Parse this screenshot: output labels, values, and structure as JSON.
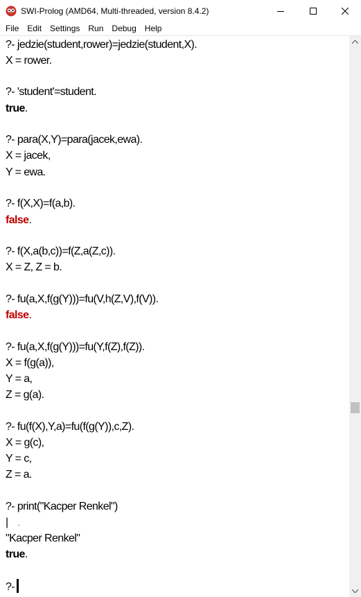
{
  "window": {
    "title": "SWI-Prolog (AMD64, Multi-threaded, version 8.4.2)"
  },
  "menu": {
    "file": "File",
    "edit": "Edit",
    "settings": "Settings",
    "run": "Run",
    "debug": "Debug",
    "help": "Help"
  },
  "console": {
    "q1": "?- jedzie(student,rower)=jedzie(student,X).",
    "a1": "X = rower.",
    "q2": "?- 'student'=student.",
    "a2": "true",
    "a2_dot": ".",
    "q3": "?- para(X,Y)=para(jacek,ewa).",
    "a3_1": "X = jacek,",
    "a3_2": "Y = ewa.",
    "q4": "?- f(X,X)=f(a,b).",
    "a4": "false",
    "a4_dot": ".",
    "q5": "?- f(X,a(b,c))=f(Z,a(Z,c)).",
    "a5": "X = Z, Z = b.",
    "q6": "?- fu(a,X,f(g(Y)))=fu(V,h(Z,V),f(V)).",
    "a6": "false",
    "a6_dot": ".",
    "q7": "?- fu(a,X,f(g(Y)))=fu(Y,f(Z),f(Z)).",
    "a7_1": "X = f(g(a)),",
    "a7_2": "Y = a,",
    "a7_3": "Z = g(a).",
    "q8": "?- fu(f(X),Y,a)=fu(f(g(Y)),c,Z).",
    "a8_1": "X = g(c),",
    "a8_2": "Y = c,",
    "a8_3": "Z = a.",
    "q9": "?- print(\"Kacper Renkel\")",
    "a9_pipe": "|",
    "a9_dot": ".",
    "a9_out": "\"Kacper Renkel\"",
    "a9_true": "true",
    "a9_true_dot": ".",
    "prompt": "?-"
  },
  "colors": {
    "false": "#c00000",
    "background": "#ffffff"
  }
}
